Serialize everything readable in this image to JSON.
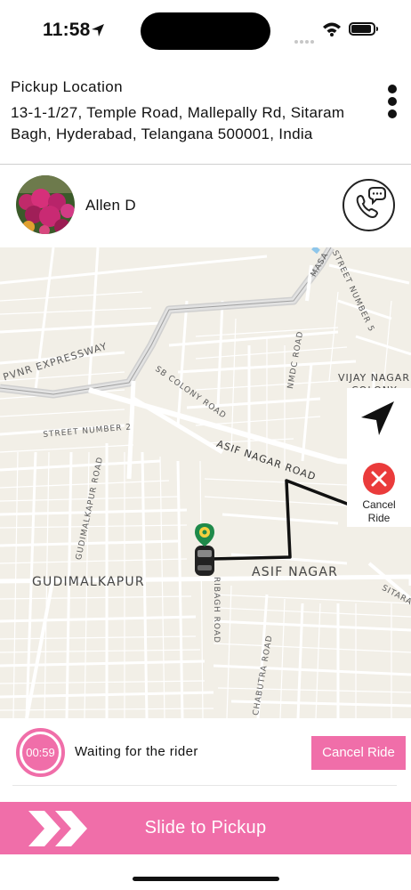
{
  "status_bar": {
    "time": "11:58",
    "icons": [
      "location-arrow-icon",
      "signal-dots-icon",
      "wifi-icon",
      "battery-icon"
    ]
  },
  "pickup": {
    "title": "Pickup Location",
    "address": "13-1-1/27, Temple Road, Mallepally Rd, Sitaram Bagh, Hyderabad, Telangana 500001, India",
    "menu_icon": "more-vertical-icon"
  },
  "rider": {
    "name": "Allen D",
    "call_icon": "phone-chat-icon"
  },
  "map": {
    "labels": {
      "pvnr": "PVNR EXPRESSWAY",
      "sb_colony": "SB COLONY ROAD",
      "street2": "STREET NUMBER 2",
      "street5": "STREET NUMBER 5",
      "nmdc": "NMDC ROAD",
      "vijay": "VIJAY NAGAR",
      "colony": "COLONY",
      "asif_road": "ASIF NAGAR ROAD",
      "gudimalkapur_road": "GUDIMALKAPUR ROAD",
      "gudimalkapur": "GUDIMALKAPUR",
      "asif": "ASIF NAGAR",
      "sitara": "SITARA",
      "bagh": "RIBAGH ROAD",
      "chabutra": "CHABUTRA ROAD",
      "masab": "MASA"
    },
    "recenter_icon": "navigation-arrow-icon",
    "cancel_icon": "close-circle-icon",
    "cancel_label": "Cancel Ride"
  },
  "waiting": {
    "timer": "00:59",
    "message": "Waiting for the rider",
    "cancel_button": "Cancel Ride"
  },
  "slide": {
    "label": "Slide to Pickup",
    "handle_icon": "double-chevron-right-icon"
  },
  "colors": {
    "accent": "#f06ea9",
    "danger": "#ea3b3b",
    "route": "#111111",
    "map_bg": "#f2efe7"
  }
}
